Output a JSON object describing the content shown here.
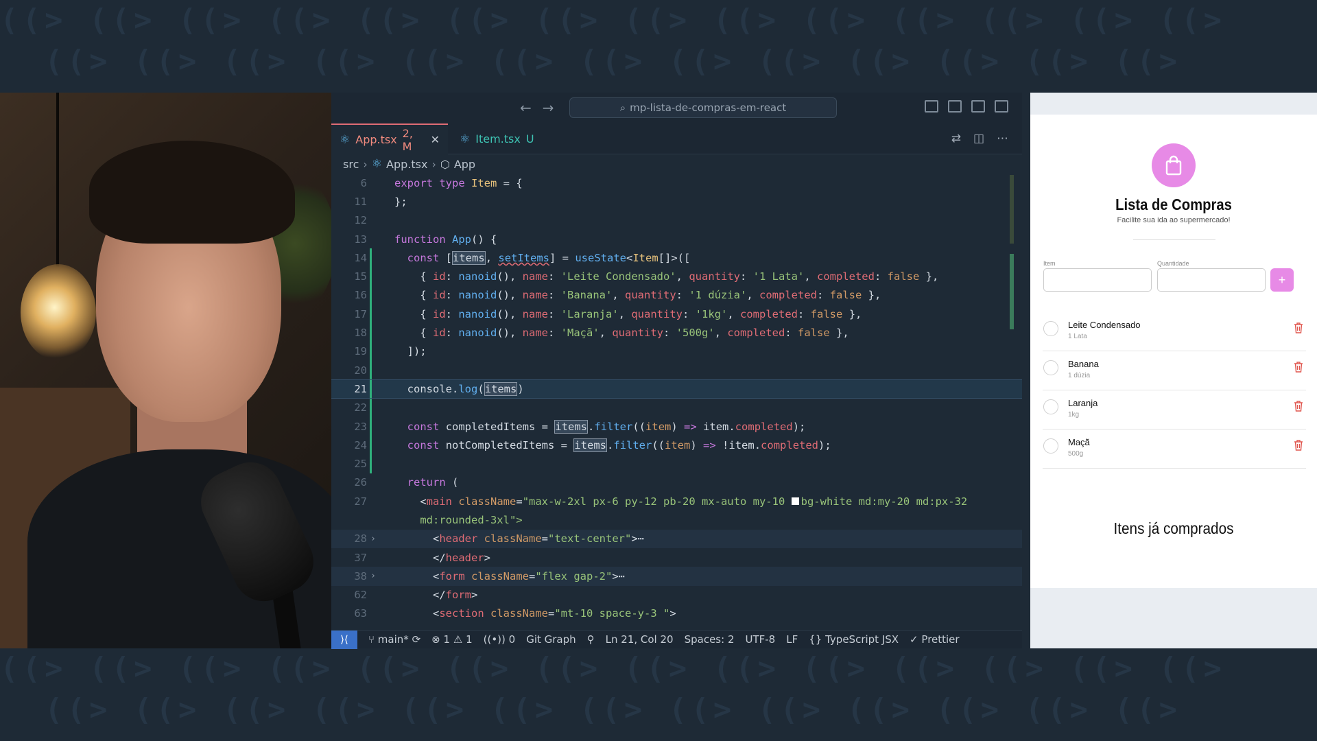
{
  "editor": {
    "command_center": "mp-lista-de-compras-em-react",
    "tabs": [
      {
        "file": "App.tsx",
        "status": "2, M"
      },
      {
        "file": "Item.tsx",
        "status": "U"
      }
    ],
    "breadcrumb": [
      "src",
      "App.tsx",
      "App"
    ],
    "lines": [
      {
        "n": "6"
      },
      {
        "n": "11"
      },
      {
        "n": "12"
      },
      {
        "n": "13"
      },
      {
        "n": "14"
      },
      {
        "n": "15"
      },
      {
        "n": "16"
      },
      {
        "n": "17"
      },
      {
        "n": "18"
      },
      {
        "n": "19"
      },
      {
        "n": "20"
      },
      {
        "n": "21"
      },
      {
        "n": "22"
      },
      {
        "n": "23"
      },
      {
        "n": "24"
      },
      {
        "n": "25"
      },
      {
        "n": "26"
      },
      {
        "n": "27"
      },
      {
        "n": ""
      },
      {
        "n": "28"
      },
      {
        "n": "37"
      },
      {
        "n": "38"
      },
      {
        "n": "62"
      },
      {
        "n": "63"
      }
    ],
    "code": {
      "l6_kw": "export type",
      "l6_ty": "Item",
      "l6_rest": " = {",
      "l11": "};",
      "l13_kw": "function",
      "l13_fn": "App",
      "l13_rest": "() {",
      "l14_kw": "const",
      "l14_items": "items",
      "l14_set": "setItems",
      "l14_use": "useState",
      "l14_ty": "Item",
      "l14_rest": "[]>([",
      "l15": [
        "nanoid",
        "'Leite Condensado'",
        "'1 Lata'",
        "false"
      ],
      "l16": [
        "nanoid",
        "'Banana'",
        "'1 dúzia'",
        "false"
      ],
      "l17": [
        "nanoid",
        "'Laranja'",
        "'1kg'",
        "false"
      ],
      "l18": [
        "nanoid",
        "'Maçã'",
        "'500g'",
        "false"
      ],
      "l19": "]);",
      "l21_console": "console",
      "l21_log": "log",
      "l21_items": "items",
      "l23_name": "completedItems",
      "l24_name": "notCompletedItems",
      "items_word": "items",
      "filter_word": "filter",
      "item_word": "item",
      "completed_word": "completed",
      "l26_kw": "return",
      "l27_tag": "main",
      "l27_class": "\"max-w-2xl px-6 py-12 pb-20 mx-auto my-10 ",
      "l27_class2": "bg-white md:my-20 md:px-32",
      "l27b": "md:rounded-3xl\">",
      "l28_tag": "header",
      "l28_class": "\"text-center\"",
      "l37_tag": "header",
      "l38_tag": "form",
      "l38_class": "\"flex gap-2\"",
      "l62_tag": "form",
      "l63_tag": "section",
      "l63_class": "\"mt-10 space-y-3 \""
    },
    "status": {
      "branch": "main*",
      "errors": "1",
      "warnings": "1",
      "ports": "0",
      "git_graph": "Git Graph",
      "position": "Ln 21, Col 20",
      "spaces": "Spaces: 2",
      "encoding": "UTF-8",
      "eol": "LF",
      "language": "TypeScript JSX",
      "prettier": "Prettier"
    }
  },
  "preview": {
    "title": "Lista de Compras",
    "subtitle": "Facilite sua ida ao supermercado!",
    "item_label": "Item",
    "qty_label": "Quantidade",
    "add_symbol": "+",
    "items": [
      {
        "name": "Leite Condensado",
        "qty": "1 Lata"
      },
      {
        "name": "Banana",
        "qty": "1 dúzia"
      },
      {
        "name": "Laranja",
        "qty": "1kg"
      },
      {
        "name": "Maçã",
        "qty": "500g"
      }
    ],
    "bought_title": "Itens já comprados"
  },
  "colors": {
    "accent": "#e78ae6",
    "trash": "#e0574f",
    "tab_active": "#f08a7e",
    "tab_untracked": "#3ec4b4"
  }
}
